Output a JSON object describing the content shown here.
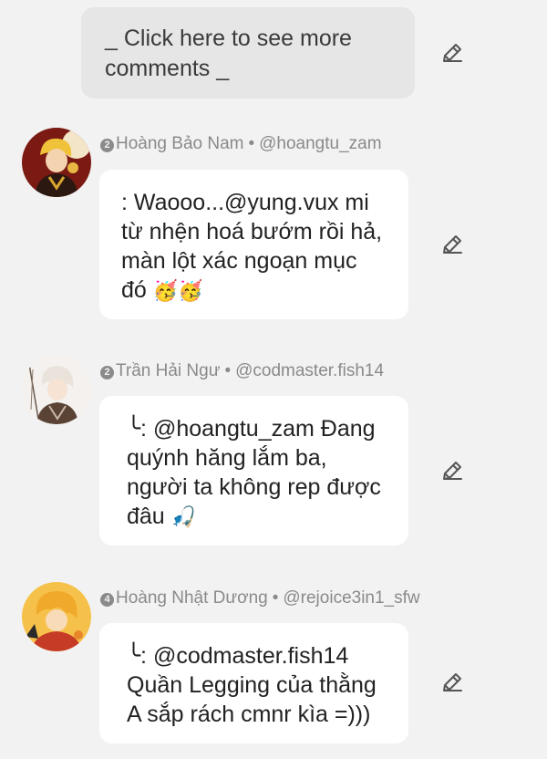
{
  "more_comments": {
    "label": "_ Click here to see more comments _"
  },
  "comments": [
    {
      "rank": "2",
      "name": "Hoàng Bảo Nam",
      "separator": "•",
      "handle": "@hoangtu_zam",
      "prefix": ": ",
      "text": "Waooo...@yung.vux mi từ nhện hoá bướm rồi hả, màn lột xác ngoạn mục đó",
      "emoji": "🥳🥳"
    },
    {
      "rank": "2",
      "name": "Trần Hải Ngư",
      "separator": "•",
      "handle": "@codmaster.fish14",
      "prefix": "╰: ",
      "text": "@hoangtu_zam Đang quýnh hăng lắm ba, người ta không rep được đâu",
      "emoji": "🎣"
    },
    {
      "rank": "4",
      "name": "Hoàng Nhật Dương",
      "separator": "•",
      "handle": "@rejoice3in1_sfw",
      "prefix": "╰: ",
      "text": "@codmaster.fish14 Quần Legging của thằng A sắp rách cmnr kìa =)))",
      "emoji": ""
    }
  ],
  "icons": {
    "edit": "pencil-edit-icon"
  }
}
